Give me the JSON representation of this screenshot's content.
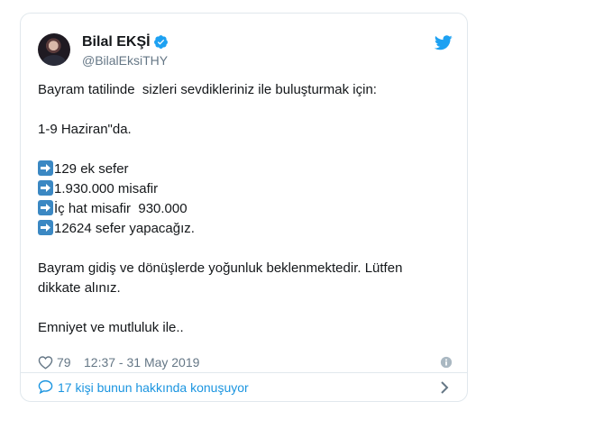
{
  "author": {
    "name": "Bilal EKŞİ",
    "handle": "@BilalEksiTHY"
  },
  "tweet": {
    "lines": [
      "Bayram tatilinde  sizleri sevdikleriniz ile buluşturmak için:",
      "",
      "1-9 Haziran\"da.",
      "",
      "129 ek sefer",
      "1.930.000 misafir",
      "İç hat misafir  930.000",
      "12624 sefer yapacağız.",
      "",
      "Bayram gidiş ve dönüşlerde yoğunluk beklenmektedir. Lütfen",
      "dikkate alınız.",
      "",
      "Emniyet ve mutluluk ile.."
    ],
    "bullet_icon": "arrow-right-emoji"
  },
  "meta": {
    "likes": "79",
    "timestamp": "12:37 - 31 May 2019"
  },
  "conversation": {
    "label": "17 kişi bunun hakkında konuşuyor"
  },
  "colors": {
    "twitter_blue": "#1da1f2",
    "link_blue": "#1b95e0",
    "secondary_text": "#657786",
    "border": "#e1e8ed",
    "arrow_emoji_bg": "#3b88c3"
  },
  "icons": [
    "verified-badge-icon",
    "twitter-bird-icon",
    "heart-icon",
    "info-icon",
    "speech-bubble-icon",
    "chevron-right-icon"
  ]
}
